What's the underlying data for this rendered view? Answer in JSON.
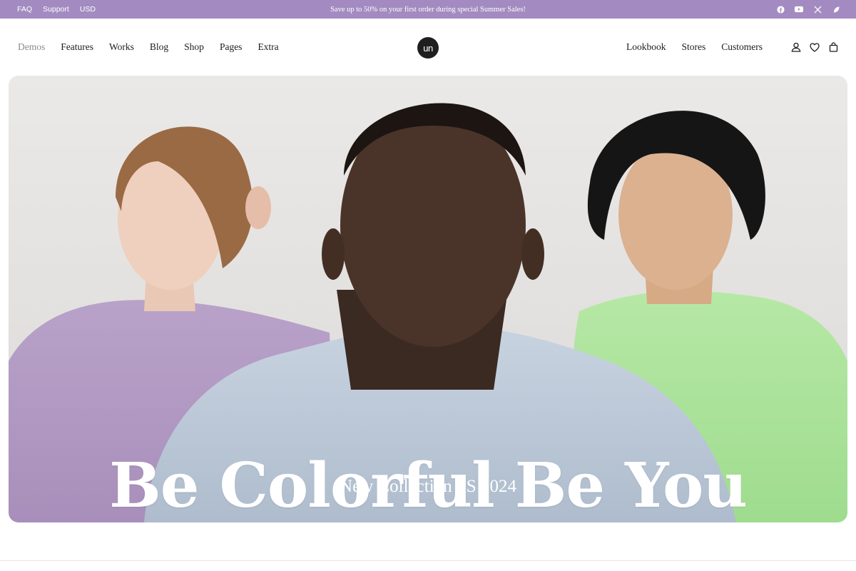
{
  "topbar": {
    "links": [
      "FAQ",
      "Support",
      "USD"
    ],
    "promo": "Save up to 50% on your first order during special Summer Sales!",
    "social_icons": [
      "facebook-icon",
      "youtube-icon",
      "x-icon",
      "threads-icon"
    ]
  },
  "header": {
    "nav_left": [
      "Demos",
      "Features",
      "Works",
      "Blog",
      "Shop",
      "Pages",
      "Extra"
    ],
    "logo": "un",
    "nav_right": [
      "Lookbook",
      "Stores",
      "Customers"
    ],
    "icons": [
      "account-icon",
      "wishlist-icon",
      "cart-icon"
    ]
  },
  "hero": {
    "title": "Be Colorful Be You",
    "subtitle": "New Collection SS 2024"
  },
  "colors": {
    "topbar_bg": "#a38bc1",
    "text": "#1c1c1c",
    "muted": "#8a8a8a"
  }
}
